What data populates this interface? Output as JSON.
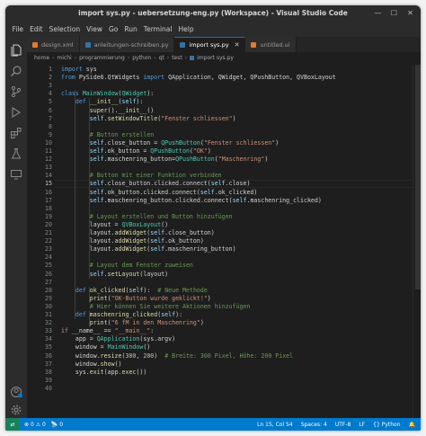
{
  "window": {
    "title": "import sys.py - uebersetzung-eng.py (Workspace) - Visual Studio Code"
  },
  "menu": [
    "File",
    "Edit",
    "Selection",
    "View",
    "Go",
    "Run",
    "Terminal",
    "Help"
  ],
  "tabs": [
    {
      "label": "design.xml",
      "icon_color": "#e37933",
      "active": false
    },
    {
      "label": "anleitungen-schreiben.py",
      "icon_color": "#3572a5",
      "active": false
    },
    {
      "label": "import sys.py",
      "icon_color": "#3572a5",
      "active": true
    },
    {
      "label": "untitled.ui",
      "icon_color": "#e37933",
      "active": false
    }
  ],
  "breadcrumb": [
    "home",
    "michi",
    "programmierung",
    "python",
    "qt",
    "test",
    "import sys.py"
  ],
  "code_lines": [
    [
      [
        "k",
        "import "
      ],
      [
        "t",
        "sys"
      ]
    ],
    [
      [
        "k",
        "from "
      ],
      [
        "t",
        "PySide6.QtWidgets "
      ],
      [
        "k",
        "import "
      ],
      [
        "t",
        "QApplication, QWidget, QPushButton, QVBoxLayout"
      ]
    ],
    [],
    [
      [
        "k",
        "class "
      ],
      [
        "cls",
        "MainWindow"
      ],
      [
        "t",
        "("
      ],
      [
        "cls",
        "QWidget"
      ],
      [
        "t",
        "):"
      ]
    ],
    [
      [
        "t",
        "    "
      ],
      [
        "k",
        "def "
      ],
      [
        "f",
        "__init__"
      ],
      [
        "t",
        "("
      ],
      [
        "v",
        "self"
      ],
      [
        "t",
        "):"
      ]
    ],
    [
      [
        "t",
        "        "
      ],
      [
        "f",
        "super"
      ],
      [
        "t",
        "()."
      ],
      [
        "f",
        "__init__"
      ],
      [
        "t",
        "()"
      ]
    ],
    [
      [
        "t",
        "        "
      ],
      [
        "v",
        "self"
      ],
      [
        "t",
        "."
      ],
      [
        "f",
        "setWindowTitle"
      ],
      [
        "t",
        "("
      ],
      [
        "s",
        "\"Fenster schliessen\""
      ],
      [
        "t",
        ")"
      ]
    ],
    [],
    [
      [
        "t",
        "        "
      ],
      [
        "c",
        "# Button erstellen"
      ]
    ],
    [
      [
        "t",
        "        "
      ],
      [
        "v",
        "self"
      ],
      [
        "t",
        ".close_button = "
      ],
      [
        "cls",
        "QPushButton"
      ],
      [
        "t",
        "("
      ],
      [
        "s",
        "\"Fenster schliessen\""
      ],
      [
        "t",
        ")"
      ]
    ],
    [
      [
        "t",
        "        "
      ],
      [
        "v",
        "self"
      ],
      [
        "t",
        ".ok_button = "
      ],
      [
        "cls",
        "QPushButton"
      ],
      [
        "t",
        "("
      ],
      [
        "s",
        "\"OK\""
      ],
      [
        "t",
        ")"
      ]
    ],
    [
      [
        "t",
        "        "
      ],
      [
        "v",
        "self"
      ],
      [
        "t",
        ".maschenring_button="
      ],
      [
        "cls",
        "QPushButton"
      ],
      [
        "t",
        "("
      ],
      [
        "s",
        "\"Maschenring\""
      ],
      [
        "t",
        ")"
      ]
    ],
    [],
    [
      [
        "t",
        "        "
      ],
      [
        "c",
        "# Button mit einer Funktion verbinden"
      ]
    ],
    [
      [
        "t",
        "        "
      ],
      [
        "v",
        "self"
      ],
      [
        "t",
        ".close_button.clicked.connect("
      ],
      [
        "v",
        "self"
      ],
      [
        "t",
        ".close)"
      ]
    ],
    [
      [
        "t",
        "        "
      ],
      [
        "v",
        "self"
      ],
      [
        "t",
        ".ok_button.clicked.connect("
      ],
      [
        "v",
        "self"
      ],
      [
        "t",
        ".ok_clicked)"
      ]
    ],
    [
      [
        "t",
        "        "
      ],
      [
        "v",
        "self"
      ],
      [
        "t",
        ".maschenring_button.clicked.connect("
      ],
      [
        "v",
        "self"
      ],
      [
        "t",
        ".maschenring_clicked)"
      ]
    ],
    [],
    [
      [
        "t",
        "        "
      ],
      [
        "c",
        "# Layout erstellen und Button hinzufügen"
      ]
    ],
    [
      [
        "t",
        "        layout = "
      ],
      [
        "cls",
        "QVBoxLayout"
      ],
      [
        "t",
        "()"
      ]
    ],
    [
      [
        "t",
        "        layout."
      ],
      [
        "f",
        "addWidget"
      ],
      [
        "t",
        "("
      ],
      [
        "v",
        "self"
      ],
      [
        "t",
        ".close_button)"
      ]
    ],
    [
      [
        "t",
        "        layout."
      ],
      [
        "f",
        "addWidget"
      ],
      [
        "t",
        "("
      ],
      [
        "v",
        "self"
      ],
      [
        "t",
        ".ok_button)"
      ]
    ],
    [
      [
        "t",
        "        layout."
      ],
      [
        "f",
        "addWidget"
      ],
      [
        "t",
        "("
      ],
      [
        "v",
        "self"
      ],
      [
        "t",
        ".maschenring_button)"
      ]
    ],
    [],
    [
      [
        "t",
        "        "
      ],
      [
        "c",
        "# Layout dem Fenster zuweisen"
      ]
    ],
    [
      [
        "t",
        "        "
      ],
      [
        "v",
        "self"
      ],
      [
        "t",
        "."
      ],
      [
        "f",
        "setLayout"
      ],
      [
        "t",
        "(layout)"
      ]
    ],
    [],
    [
      [
        "t",
        "    "
      ],
      [
        "k",
        "def "
      ],
      [
        "f",
        "ok_clicked"
      ],
      [
        "t",
        "("
      ],
      [
        "v",
        "self"
      ],
      [
        "t",
        "):  "
      ],
      [
        "c",
        "# Neue Methode"
      ]
    ],
    [
      [
        "t",
        "        "
      ],
      [
        "f",
        "print"
      ],
      [
        "t",
        "("
      ],
      [
        "s",
        "\"OK-Button wurde geklickt!\""
      ],
      [
        "t",
        ")"
      ]
    ],
    [
      [
        "t",
        "        "
      ],
      [
        "c",
        "# Hier können Sie weitere Aktionen hinzufügen"
      ]
    ],
    [
      [
        "t",
        "    "
      ],
      [
        "k",
        "def "
      ],
      [
        "f",
        "maschenring_clicked"
      ],
      [
        "t",
        "("
      ],
      [
        "v",
        "self"
      ],
      [
        "t",
        "):"
      ]
    ],
    [
      [
        "t",
        "        "
      ],
      [
        "f",
        "print"
      ],
      [
        "t",
        "("
      ],
      [
        "s",
        "\"6 fM in den Maschenring\""
      ],
      [
        "t",
        ")"
      ]
    ],
    [
      [
        "p",
        "if "
      ],
      [
        "t",
        "__name__ == "
      ],
      [
        "s",
        "\"__main__\""
      ],
      [
        "t",
        ":"
      ]
    ],
    [
      [
        "t",
        "    app = "
      ],
      [
        "cls",
        "QApplication"
      ],
      [
        "t",
        "(sys.argv)"
      ]
    ],
    [
      [
        "t",
        "    window = "
      ],
      [
        "cls",
        "MainWindow"
      ],
      [
        "t",
        "()"
      ]
    ],
    [
      [
        "t",
        "    window."
      ],
      [
        "f",
        "resize"
      ],
      [
        "t",
        "("
      ],
      [
        "n",
        "300"
      ],
      [
        "t",
        ", "
      ],
      [
        "n",
        "200"
      ],
      [
        "t",
        ")  "
      ],
      [
        "c",
        "# Breite: 300 Pixel, Höhe: 200 Pixel"
      ]
    ],
    [
      [
        "t",
        "    window."
      ],
      [
        "f",
        "show"
      ],
      [
        "t",
        "()"
      ]
    ],
    [
      [
        "t",
        "    sys."
      ],
      [
        "f",
        "exit"
      ],
      [
        "t",
        "(app."
      ],
      [
        "f",
        "exec"
      ],
      [
        "t",
        "())"
      ]
    ],
    [],
    []
  ],
  "current_line": 15,
  "status": {
    "errors": "0",
    "warnings": "0",
    "ports": "0",
    "cursor": "Ln 15, Col 54",
    "spaces": "Spaces: 4",
    "encoding": "UTF-8",
    "eol": "LF",
    "language": "Python",
    "bar_color": "#007acc"
  },
  "icons": [
    "explorer-icon",
    "search-icon",
    "source-control-icon",
    "run-debug-icon",
    "extensions-icon",
    "testing-icon",
    "remote-explorer-icon",
    "account-icon",
    "settings-gear-icon"
  ]
}
